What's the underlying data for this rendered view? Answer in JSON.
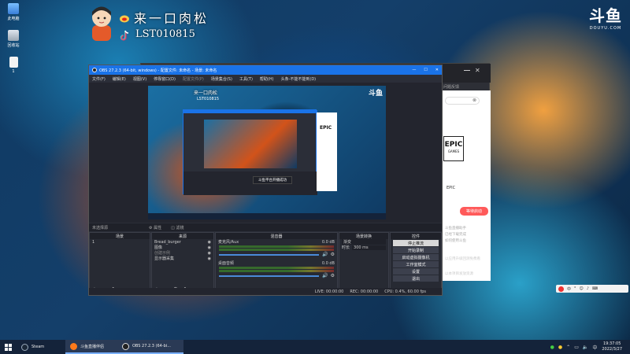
{
  "desktop": {
    "icons": [
      {
        "label": "此电脑"
      },
      {
        "label": "回收站"
      },
      {
        "label": "1"
      }
    ]
  },
  "overlay": {
    "streamer_name": "来一口肉松",
    "tiktok_id": "LST010815",
    "brand": "斗鱼",
    "brand_sub": "DOUYU.COM"
  },
  "obs": {
    "title": "OBS 27.2.3 (64-bit, windows) - 配置文件: 未命名 - 场景: 未命名",
    "menu": [
      "文件(F)",
      "编辑(E)",
      "视图(V)",
      "停靠窗口(D)",
      "配置文件(P)",
      "场景集合(S)",
      "工具(T)",
      "帮助(H)",
      "头条-不能不能到(D)"
    ],
    "source_hint": "未选择源",
    "properties_label": "属性",
    "filters_label": "滤镜",
    "panels": {
      "scenes": {
        "title": "场景",
        "items": [
          "1"
        ]
      },
      "sources": {
        "title": "来源",
        "items": [
          "Bread_burger",
          "图像",
          "创建示例",
          "显示器采集"
        ]
      },
      "mixer": {
        "title": "混音器",
        "tracks": [
          {
            "name": "麦克风/Aux",
            "db": "0.0 dB"
          },
          {
            "name": "桌面音频",
            "db": "0.0 dB"
          }
        ]
      },
      "transition": {
        "title": "场景转换",
        "type": "渐变",
        "duration_label": "时长",
        "duration": "300 ms"
      },
      "controls": {
        "title": "控件",
        "buttons": [
          "停止推流",
          "开始录制",
          "启动虚拟摄像机",
          "工作室模式",
          "设置",
          "退出"
        ]
      }
    },
    "status": {
      "live": "LIVE: 00:00:00",
      "rec": "REC: 00:00:00",
      "cpu": "CPU: 0.4%, 60.00 fps"
    },
    "nested_toast": "斗鱼平台开播成功"
  },
  "browser": {
    "header_text": "问题反馈",
    "epic_logo": "EPIC",
    "epic_sub": "GAMES",
    "epic_name": "EPIC",
    "install_button": "等待启动",
    "links": [
      "斗鱼直播助手",
      "已经下载完成",
      "如何使用斗鱼",
      "以应用升级回测免费看",
      "斗鱼社区推荐",
      "以本项目发放资源"
    ]
  },
  "taskbar": {
    "items": [
      {
        "label": "Steam"
      },
      {
        "label": "斗鱼直播伴侣"
      },
      {
        "label": "OBS 27.2.3 (64-bi..."
      }
    ],
    "time": "19:37:05",
    "date": "2022/3/27"
  },
  "colors": {
    "accent_red": "#ff4a3c",
    "obs_blue": "#1a73e8",
    "epic_red": "#ff5a5a"
  }
}
